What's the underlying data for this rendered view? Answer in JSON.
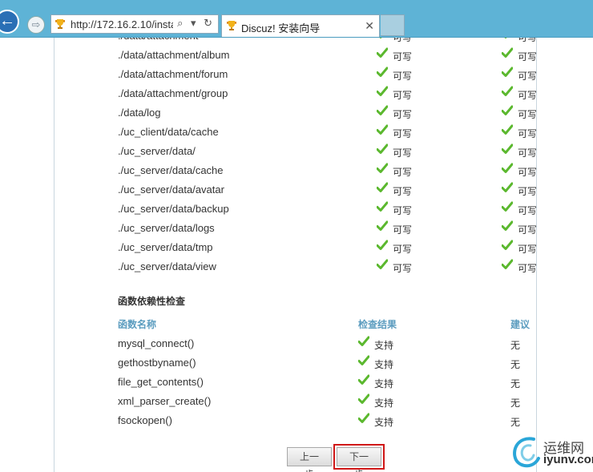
{
  "browser": {
    "address_url": "http://172.16.2.10/insta",
    "tab_title": "Discuz! 安装向导",
    "back_glyph": "←",
    "forward_glyph": "⇨",
    "address_controls": "⌕ ▾ ↻",
    "close_tab_glyph": "✕"
  },
  "directories": [
    {
      "path": "./data/attachment",
      "status_current": "可写",
      "status_required": "可写"
    },
    {
      "path": "./data/attachment/album",
      "status_current": "可写",
      "status_required": "可写"
    },
    {
      "path": "./data/attachment/forum",
      "status_current": "可写",
      "status_required": "可写"
    },
    {
      "path": "./data/attachment/group",
      "status_current": "可写",
      "status_required": "可写"
    },
    {
      "path": "./data/log",
      "status_current": "可写",
      "status_required": "可写"
    },
    {
      "path": "./uc_client/data/cache",
      "status_current": "可写",
      "status_required": "可写"
    },
    {
      "path": "./uc_server/data/",
      "status_current": "可写",
      "status_required": "可写"
    },
    {
      "path": "./uc_server/data/cache",
      "status_current": "可写",
      "status_required": "可写"
    },
    {
      "path": "./uc_server/data/avatar",
      "status_current": "可写",
      "status_required": "可写"
    },
    {
      "path": "./uc_server/data/backup",
      "status_current": "可写",
      "status_required": "可写"
    },
    {
      "path": "./uc_server/data/logs",
      "status_current": "可写",
      "status_required": "可写"
    },
    {
      "path": "./uc_server/data/tmp",
      "status_current": "可写",
      "status_required": "可写"
    },
    {
      "path": "./uc_server/data/view",
      "status_current": "可写",
      "status_required": "可写"
    }
  ],
  "functions_section": {
    "title": "函数依赖性检查",
    "headers": {
      "name": "函数名称",
      "result": "检查结果",
      "suggestion": "建议"
    },
    "rows": [
      {
        "name": "mysql_connect()",
        "result": "支持",
        "suggestion": "无"
      },
      {
        "name": "gethostbyname()",
        "result": "支持",
        "suggestion": "无"
      },
      {
        "name": "file_get_contents()",
        "result": "支持",
        "suggestion": "无"
      },
      {
        "name": "xml_parser_create()",
        "result": "支持",
        "suggestion": "无"
      },
      {
        "name": "fsockopen()",
        "result": "支持",
        "suggestion": "无"
      }
    ]
  },
  "buttons": {
    "prev": "上一步",
    "next": "下一步"
  },
  "watermark": {
    "cn": "运维网",
    "en": "iyunv.com"
  },
  "colors": {
    "check": "#5bb82e",
    "header_text": "#5b9cbf",
    "highlight_border": "#d01818",
    "chrome": "#5eb3d6"
  },
  "icons": {
    "status": "check-icon",
    "favicon": "trophy-favicon-icon"
  }
}
